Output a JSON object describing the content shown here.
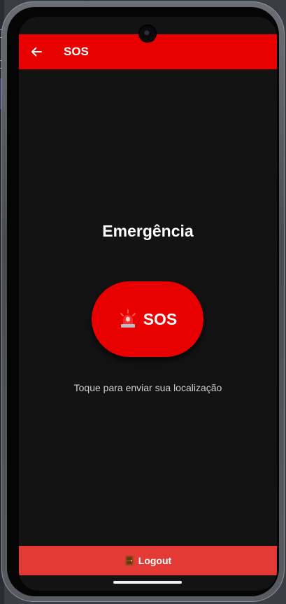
{
  "app_bar": {
    "title": "SOS",
    "back_icon": "arrow-left-icon",
    "background": "#e80000"
  },
  "main": {
    "heading": "Emergência",
    "sos_button": {
      "icon": "siren-icon",
      "label": "SOS",
      "background": "#e80000"
    },
    "hint": "Toque para enviar sua localização"
  },
  "footer": {
    "logout_icon": "door-icon",
    "logout_label": "Logout",
    "background": "#e43a36"
  },
  "colors": {
    "screen_background": "#131313",
    "text_primary": "#ffffff",
    "text_secondary": "#cfcfcf"
  }
}
